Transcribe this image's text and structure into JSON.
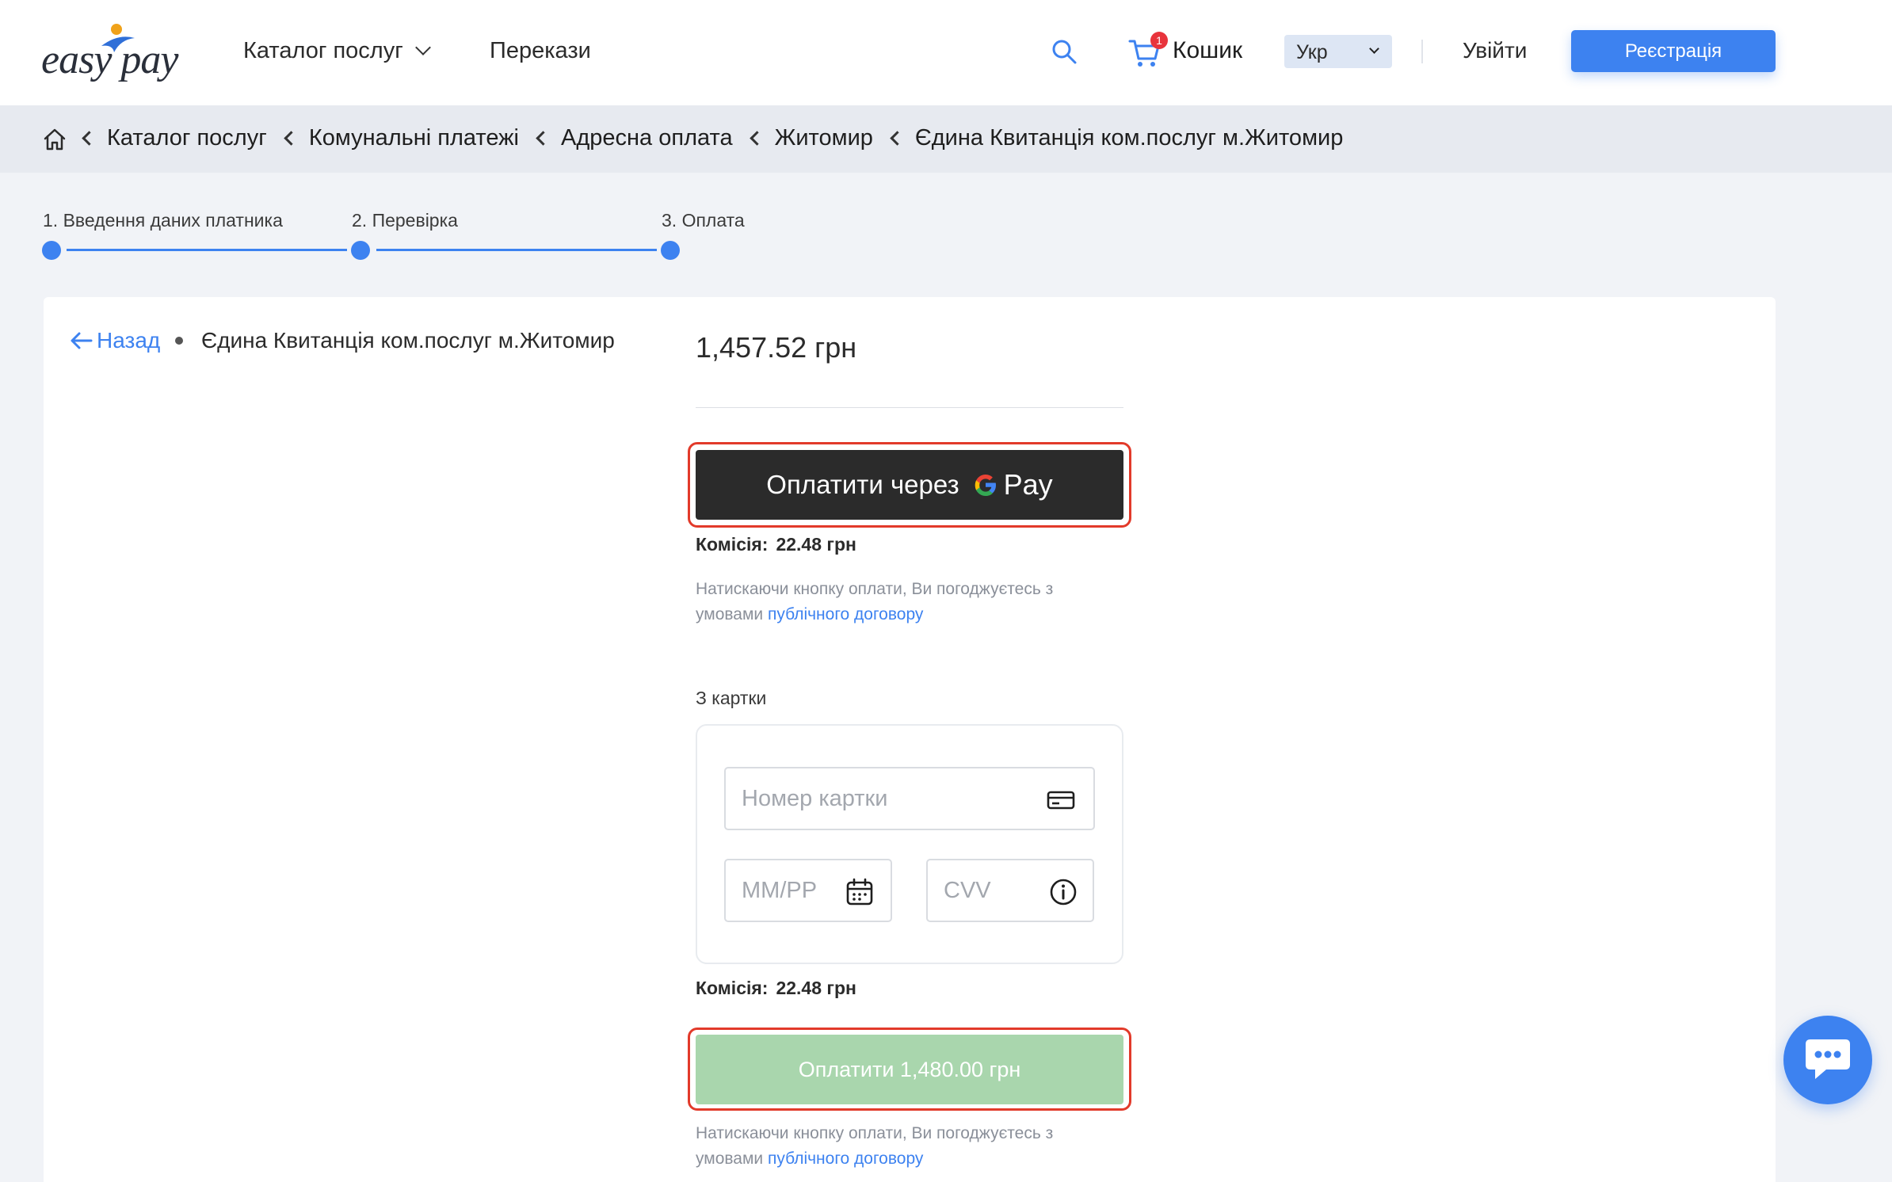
{
  "header": {
    "logo_text": "easy pay",
    "nav": {
      "catalog": "Каталог послуг",
      "transfers": "Перекази"
    },
    "cart": {
      "label": "Кошик",
      "count": "1"
    },
    "language": "Укр",
    "login": "Увійти",
    "register": "Реєстрація"
  },
  "breadcrumb": [
    "Каталог послуг",
    "Комунальні платежі",
    "Адресна оплата",
    "Житомир",
    "Єдина Квитанція ком.послуг м.Житомир"
  ],
  "steps": [
    "1. Введення даних платника",
    "2. Перевірка",
    "3. Оплата"
  ],
  "payment": {
    "back": "Назад",
    "service_title": "Єдина Квитанція ком.послуг м.Житомир",
    "amount": "1,457.52 грн",
    "gpay_label": "Оплатити через",
    "gpay_pay": "Pay",
    "fee_label": "Комісія:",
    "fee_value": "22.48 грн",
    "terms_text": "Натискаючи кнопку оплати, Ви погоджуєтесь з умовами",
    "terms_link": "публічного договору",
    "card_section_label": "З картки",
    "card_number_placeholder": "Номер картки",
    "expiry_placeholder": "ММ/РР",
    "cvv_placeholder": "CVV",
    "pay_button": "Оплатити 1,480.00 грн"
  },
  "colors": {
    "accent": "#3d82f0",
    "highlight": "#e23a2a",
    "pay_button": "#a9d6ad",
    "gpay_button": "#2b2b2b"
  },
  "icons": [
    "search-icon",
    "cart-icon",
    "home-icon",
    "back-arrow-icon",
    "google-g-icon",
    "card-icon",
    "calendar-icon",
    "info-icon",
    "chat-icon"
  ]
}
